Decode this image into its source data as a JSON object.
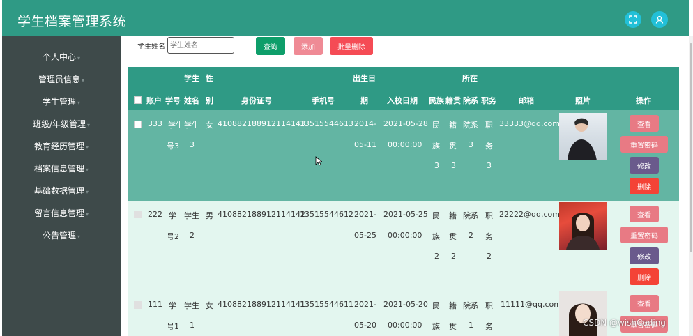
{
  "app": {
    "title": "学生档案管理系统"
  },
  "header": {
    "fullscreen_icon": "fullscreen-icon",
    "user_icon": "user-icon"
  },
  "sidebar": {
    "items": [
      {
        "label": "个人中心"
      },
      {
        "label": "管理员信息"
      },
      {
        "label": "学生管理"
      },
      {
        "label": "班级/年级管理"
      },
      {
        "label": "教育经历管理"
      },
      {
        "label": "档案信息管理"
      },
      {
        "label": "基础数据管理"
      },
      {
        "label": "留言信息管理"
      },
      {
        "label": "公告管理"
      }
    ]
  },
  "search": {
    "label": "学生姓名",
    "placeholder": "学生姓名",
    "value": ""
  },
  "toolbar": {
    "query": "查询",
    "add": "添加",
    "batch_delete": "批量删除"
  },
  "table": {
    "headers": {
      "account": "账户",
      "student_no": "学号",
      "name": "姓名",
      "gender_1": "性",
      "gender_2": "别",
      "name_top": "学生",
      "id_card": "身份证号",
      "phone": "手机号",
      "birth_1": "出生日",
      "birth_2": "期",
      "enroll": "入校日期",
      "ethnic": "民族",
      "native": "籍贯",
      "dept_1": "所在",
      "dept_2": "院系",
      "position": "职务",
      "email": "邮箱",
      "photo": "照片",
      "ops": "操作"
    },
    "rows": [
      {
        "account": "333",
        "sno": [
          "学生",
          "号3"
        ],
        "name": [
          "学生",
          "3"
        ],
        "gender": "女",
        "id": "410882188912114143",
        "phone": "13515544613",
        "birth": [
          "2014-",
          "05-11"
        ],
        "enroll": [
          "2021-05-28",
          "00:00:00"
        ],
        "ethnic": [
          "民",
          "族",
          "3"
        ],
        "native": [
          "籍",
          "贯",
          "3"
        ],
        "dept": [
          "院系",
          "3"
        ],
        "pos": [
          "职",
          "务",
          "3"
        ],
        "email": "33333@qq.com"
      },
      {
        "account": "222",
        "sno": [
          "学",
          "号2"
        ],
        "name": [
          "学生",
          "2"
        ],
        "gender": "男",
        "id": "410882188912114142",
        "phone": "13515544612",
        "birth": [
          "2021-",
          "05-25"
        ],
        "enroll": [
          "2021-05-25",
          "00:00:00"
        ],
        "ethnic": [
          "民",
          "族",
          "2"
        ],
        "native": [
          "籍",
          "贯",
          "2"
        ],
        "dept": [
          "院系",
          "2"
        ],
        "pos": [
          "职",
          "务",
          "2"
        ],
        "email": "22222@qq.com"
      },
      {
        "account": "111",
        "sno": [
          "学",
          "号1"
        ],
        "name": [
          "学生",
          "1"
        ],
        "gender": "女",
        "id": "410882188912114141",
        "phone": "13515544611",
        "birth": [
          "2021-",
          "05-20"
        ],
        "enroll": [
          "2021-05-20",
          "00:00:00"
        ],
        "ethnic": [
          "民",
          "族"
        ],
        "native": [
          "籍",
          "贯"
        ],
        "dept": [
          "院系",
          "1"
        ],
        "pos": [
          "职",
          "务"
        ],
        "email": "11111@qq.com"
      }
    ],
    "actions": {
      "view": "查看",
      "reset": "重置密码",
      "edit": "修改",
      "delete": "删除"
    }
  },
  "watermark": "CSDN @wishCoding",
  "colors": {
    "header": "#2f9a85",
    "sidebar": "#3e4a4a",
    "row_selected": "#63b5a3",
    "row_light": "#e3f6ef",
    "btn_view": "#e87a84",
    "btn_edit": "#6a5a8c",
    "btn_delete": "#f44336"
  }
}
